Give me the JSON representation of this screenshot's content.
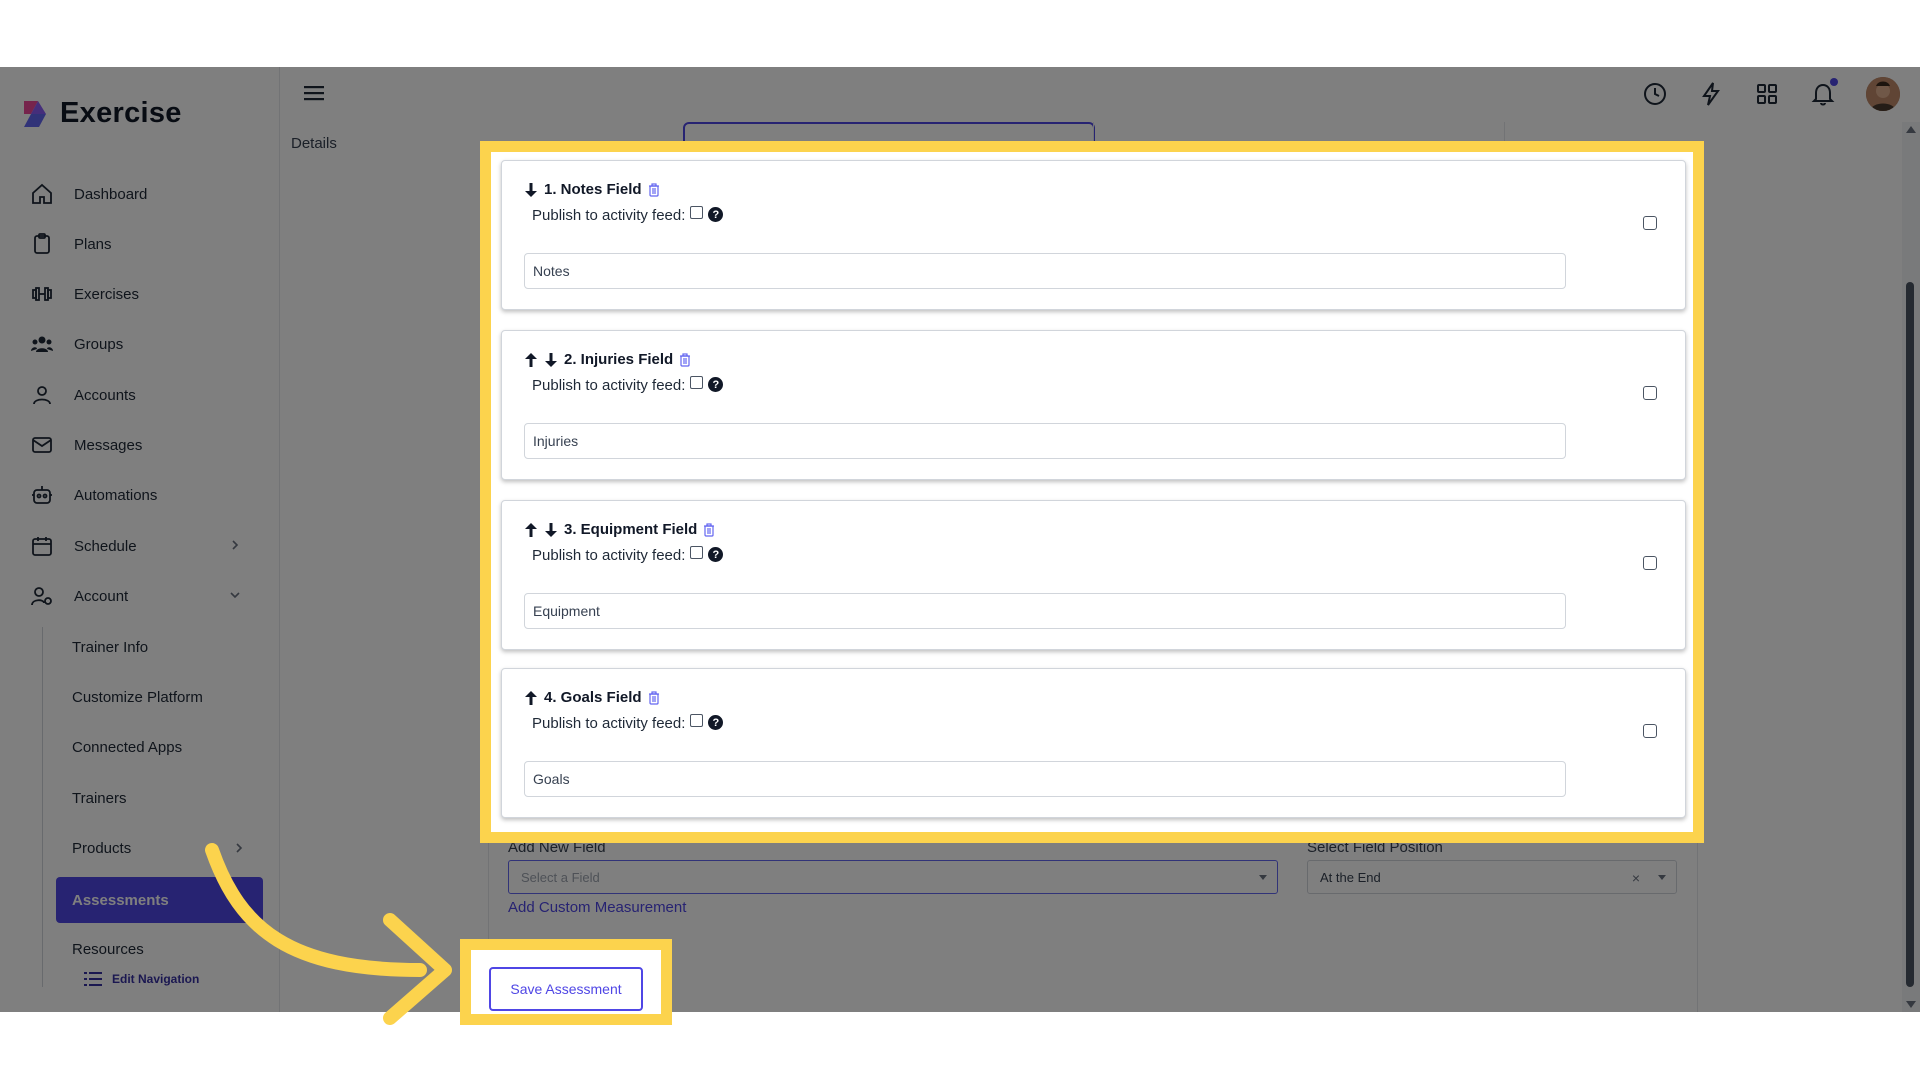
{
  "brand": {
    "name": "Exercise"
  },
  "sidebar": {
    "items": [
      {
        "label": "Dashboard",
        "icon": "home-icon"
      },
      {
        "label": "Plans",
        "icon": "clipboard-icon"
      },
      {
        "label": "Exercises",
        "icon": "dumbbell-icon"
      },
      {
        "label": "Groups",
        "icon": "users-icon"
      },
      {
        "label": "Accounts",
        "icon": "user-icon"
      },
      {
        "label": "Messages",
        "icon": "envelope-icon"
      },
      {
        "label": "Automations",
        "icon": "robot-icon"
      },
      {
        "label": "Schedule",
        "icon": "calendar-icon"
      },
      {
        "label": "Account",
        "icon": "user-gear-icon"
      }
    ],
    "account_sub": [
      {
        "label": "Trainer Info"
      },
      {
        "label": "Customize Platform"
      },
      {
        "label": "Connected Apps"
      },
      {
        "label": "Trainers"
      },
      {
        "label": "Products"
      },
      {
        "label": "Assessments",
        "active": true
      },
      {
        "label": "Resources"
      }
    ],
    "edit_navigation": "Edit Navigation"
  },
  "tabs": {
    "details": "Details"
  },
  "fields": [
    {
      "title": "1. Notes Field",
      "publish_label": "Publish to activity feed:",
      "help": "?",
      "value": "Notes",
      "up": false,
      "down": true
    },
    {
      "title": "2. Injuries Field",
      "publish_label": "Publish to activity feed:",
      "help": "?",
      "value": "Injuries",
      "up": true,
      "down": true
    },
    {
      "title": "3. Equipment Field",
      "publish_label": "Publish to activity feed:",
      "help": "?",
      "value": "Equipment",
      "up": true,
      "down": true
    },
    {
      "title": "4. Goals Field",
      "publish_label": "Publish to activity feed:",
      "help": "?",
      "value": "Goals",
      "up": true,
      "down": false
    }
  ],
  "add_field": {
    "label": "Add New Field",
    "placeholder": "Select a Field",
    "position_label": "Select Field Position",
    "position_value": "At the End",
    "clear": "×",
    "custom_link": "Add Custom Measurement"
  },
  "save_button": "Save Assessment",
  "colors": {
    "accent": "#4f46e5",
    "highlight": "#fcd34d",
    "active_nav": "#4f46e5"
  }
}
